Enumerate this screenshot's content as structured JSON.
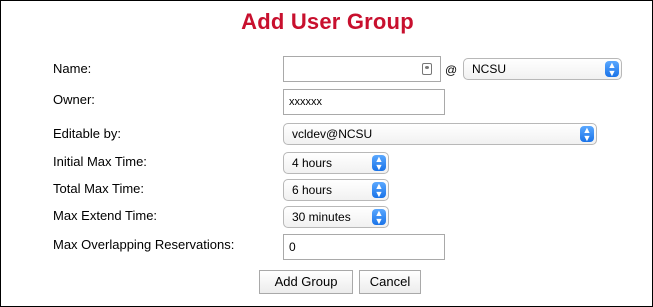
{
  "dialog": {
    "title": "Add User Group"
  },
  "fields": {
    "name": {
      "label": "Name:",
      "value": "",
      "at_symbol": "@"
    },
    "affiliation": {
      "selected": "NCSU"
    },
    "owner": {
      "label": "Owner:",
      "value": "xxxxxx"
    },
    "editable_by": {
      "label": "Editable by:",
      "selected": "vcldev@NCSU"
    },
    "initial_max_time": {
      "label": "Initial Max Time:",
      "selected": "4 hours"
    },
    "total_max_time": {
      "label": "Total Max Time:",
      "selected": "6 hours"
    },
    "max_extend_time": {
      "label": "Max Extend Time:",
      "selected": "30 minutes"
    },
    "max_overlapping": {
      "label": "Max Overlapping Reservations:",
      "value": "0"
    }
  },
  "buttons": {
    "add_group": "Add Group",
    "cancel": "Cancel"
  },
  "colors": {
    "title": "#c8102e",
    "select_arrow": "#1a73e8"
  },
  "icons": {
    "select_arrow": "updown-chevron-icon",
    "name_field": "contact-card-icon"
  }
}
